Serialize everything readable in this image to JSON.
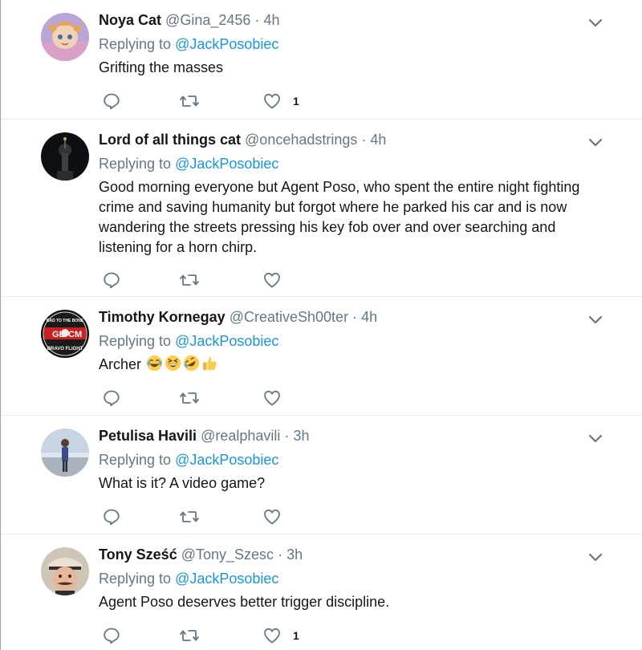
{
  "tweets": [
    {
      "name": "Noya Cat",
      "handle": "@Gina_2456",
      "time": "4h",
      "replying_prefix": "Replying to",
      "replying_to": "@JackPosobiec",
      "text": "Grifting the masses",
      "likes": "1"
    },
    {
      "name": "Lord of all things cat",
      "handle": "@oncehadstrings",
      "time": "4h",
      "replying_prefix": "Replying to",
      "replying_to": "@JackPosobiec",
      "text": "Good morning everyone but Agent Poso, who spent the entire night fighting crime and saving humanity but forgot where he parked his car and is now wandering the streets pressing his key fob over and over searching and listening for a horn chirp."
    },
    {
      "name": "Timothy Kornegay",
      "handle": "@CreativeSh00ter",
      "time": "4h",
      "replying_prefix": "Replying to",
      "replying_to": "@JackPosobiec",
      "text": "Archer",
      "emoji": [
        "joy-emoji",
        "grinning-squint-emoji",
        "rofl-emoji",
        "thumbs-up-emoji"
      ],
      "avatar_text": {
        "top": "BAD TO THE BONE",
        "left": "GL",
        "right": "CM",
        "bottom": "BRAVO FLIGHT"
      }
    },
    {
      "name": "Petulisa Havili",
      "handle": "@realphavili",
      "time": "3h",
      "replying_prefix": "Replying to",
      "replying_to": "@JackPosobiec",
      "text": "What is it? A video game?"
    },
    {
      "name": "Tony Sześć",
      "handle": "@Tony_Szesc",
      "time": "3h",
      "replying_prefix": "Replying to",
      "replying_to": "@JackPosobiec",
      "text": "Agent Poso deserves better trigger discipline.",
      "likes": "1"
    }
  ],
  "colors": {
    "link": "#1b95e0",
    "secondary_text": "#657786",
    "primary_text": "#14171a",
    "divider": "#e6ecf0"
  },
  "icons": {
    "reply": "reply-icon",
    "retweet": "retweet-icon",
    "like": "like-icon",
    "caret": "chevron-down-icon"
  }
}
